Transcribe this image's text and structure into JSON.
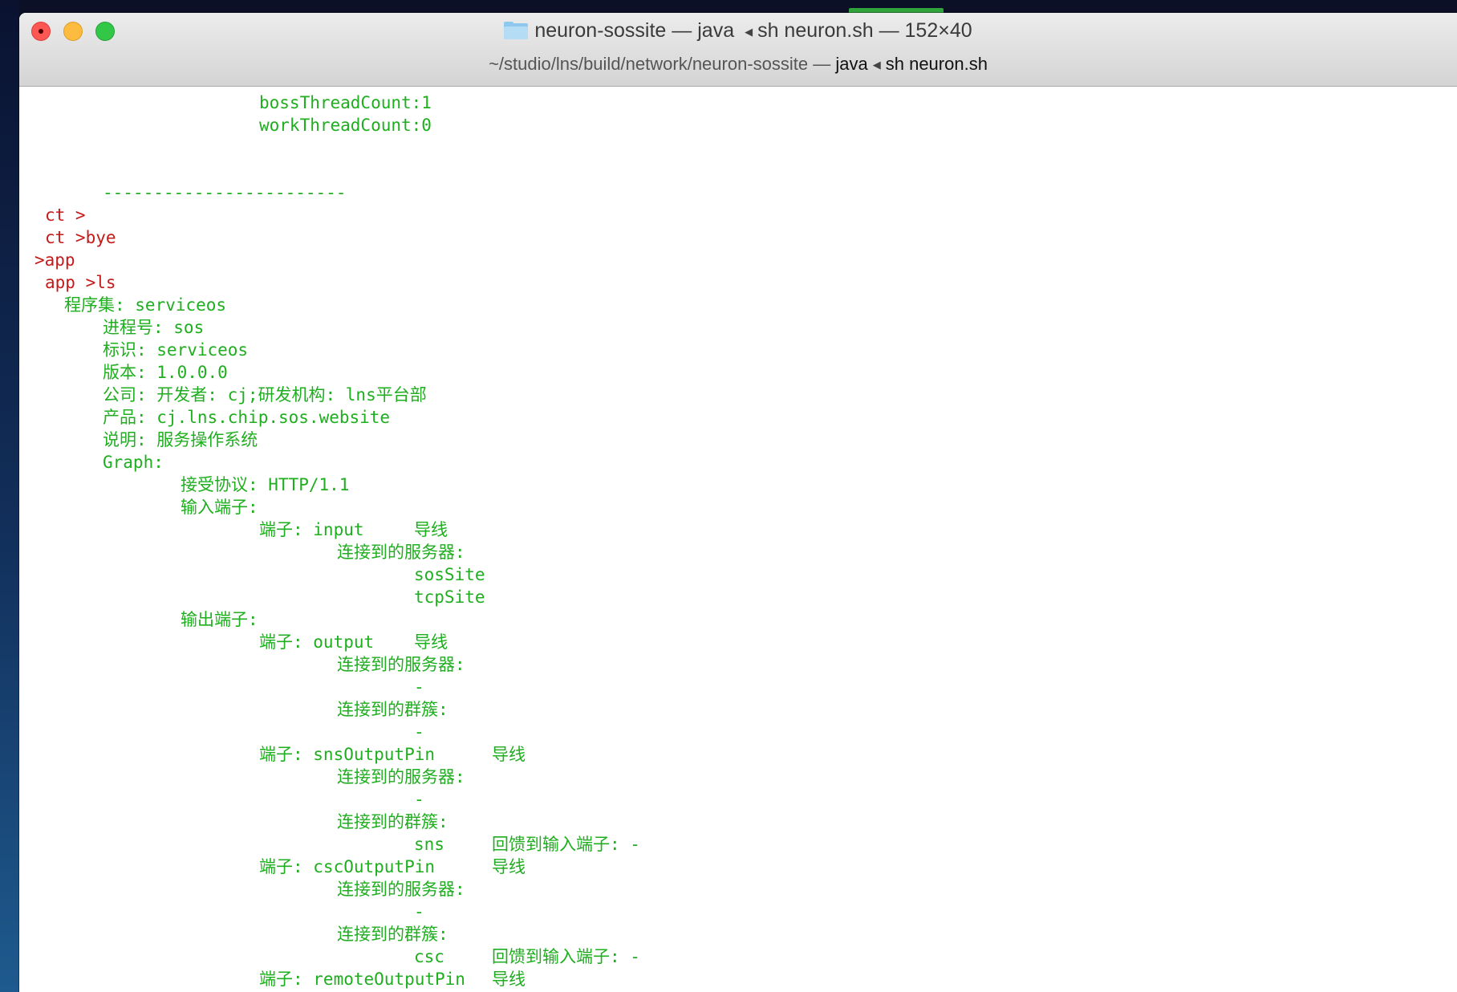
{
  "window": {
    "title": {
      "folder": "neuron-sossite",
      "sep1": "—",
      "process": "java",
      "shell": "sh neuron.sh",
      "sep2": "—",
      "size": "152×40"
    },
    "subtitle": {
      "path": "~/studio/lns/build/network/neuron-sossite",
      "sep": "—",
      "process": "java",
      "shell": "sh neuron.sh"
    }
  },
  "colors": {
    "output_green": "#1fae1f",
    "prompt_red": "#c41a1a"
  },
  "terminal": {
    "l01": "bossThreadCount:1",
    "l02": "workThreadCount:0",
    "l03": "",
    "l04": "",
    "l05": "------------------------",
    "l06": "ct >",
    "l07": "ct >bye",
    "l08": ">app",
    "l09": "app >ls",
    "l10": "程序集: serviceos",
    "l11": "进程号: sos",
    "l12": "标识: serviceos",
    "l13": "版本: 1.0.0.0",
    "l14": "公司: 开发者: cj;研发机构: lns平台部",
    "l15": "产品: cj.lns.chip.sos.website",
    "l16": "说明: 服务操作系统",
    "l17": "Graph:",
    "l18": "接受协议: HTTP/1.1",
    "l19": "输入端子:",
    "l20a": "端子: input",
    "l20b": "导线",
    "l21": "连接到的服务器:",
    "l22": "sosSite",
    "l23": "tcpSite",
    "l24": "输出端子:",
    "l25a": "端子: output",
    "l25b": "导线",
    "l26": "连接到的服务器:",
    "l27": "-",
    "l28": "连接到的群簇:",
    "l29": "-",
    "l30a": "端子: snsOutputPin",
    "l30b": "导线",
    "l31": "连接到的服务器:",
    "l32": "-",
    "l33": "连接到的群簇:",
    "l34a": "sns",
    "l34b": "回馈到输入端子: -",
    "l35a": "端子: cscOutputPin",
    "l35b": "导线",
    "l36": "连接到的服务器:",
    "l37": "-",
    "l38": "连接到的群簇:",
    "l39a": "csc",
    "l39b": "回馈到输入端子: -",
    "l40a": "端子: remoteOutputPin",
    "l40b": "导线"
  }
}
